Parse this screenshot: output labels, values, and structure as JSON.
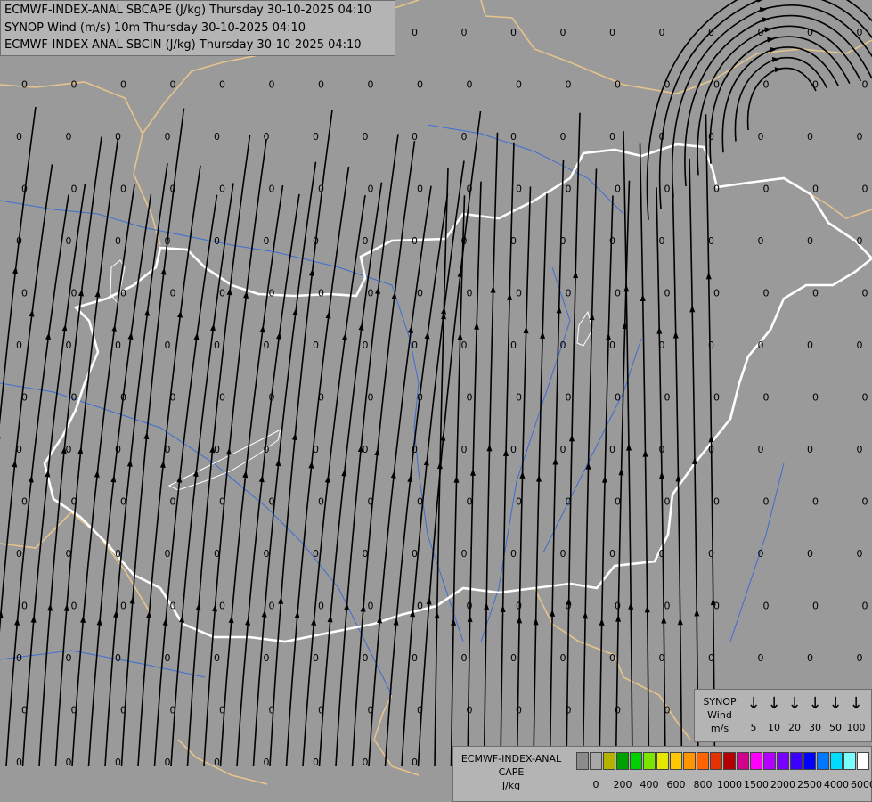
{
  "header": {
    "line1": "ECMWF-INDEX-ANAL SBCAPE (J/kg) Thursday 30-10-2025 04:10",
    "line2": "SYNOP Wind (m/s) 10m Thursday 30-10-2025 04:10",
    "line3": "ECMWF-INDEX-ANAL SBCIN (J/kg) Thursday 30-10-2025 04:10"
  },
  "map": {
    "grid_value": "0",
    "colors": {
      "background": "#9a9a9a",
      "borders": "#e6c48c",
      "country_border": "#ffffff",
      "rivers": "#3c6ed2",
      "streamlines": "#000000"
    }
  },
  "cape_legend": {
    "title_line1": "ECMWF-INDEX-ANAL",
    "title_line2": "CAPE",
    "unit": "J/kg",
    "colors": [
      "#8c8c8c",
      "#a8a8a8",
      "#b4b400",
      "#00a000",
      "#00d200",
      "#7ae600",
      "#e6e600",
      "#ffc800",
      "#ff9600",
      "#ff6400",
      "#e63200",
      "#b40000",
      "#d2008c",
      "#ff00ff",
      "#b400ff",
      "#7800ff",
      "#3c00ff",
      "#0000ff",
      "#0078ff",
      "#00dcff",
      "#7affff",
      "#ffffff"
    ],
    "labels": [
      "0",
      "200",
      "400",
      "600",
      "800",
      "1000",
      "1500",
      "2000",
      "2500",
      "4000",
      "6000"
    ]
  },
  "synop_legend": {
    "title_line1": "SYNOP",
    "title_line2": "Wind",
    "unit": "m/s",
    "speeds": [
      "5",
      "10",
      "20",
      "30",
      "50",
      "100"
    ],
    "arrow_icon": "↓"
  }
}
